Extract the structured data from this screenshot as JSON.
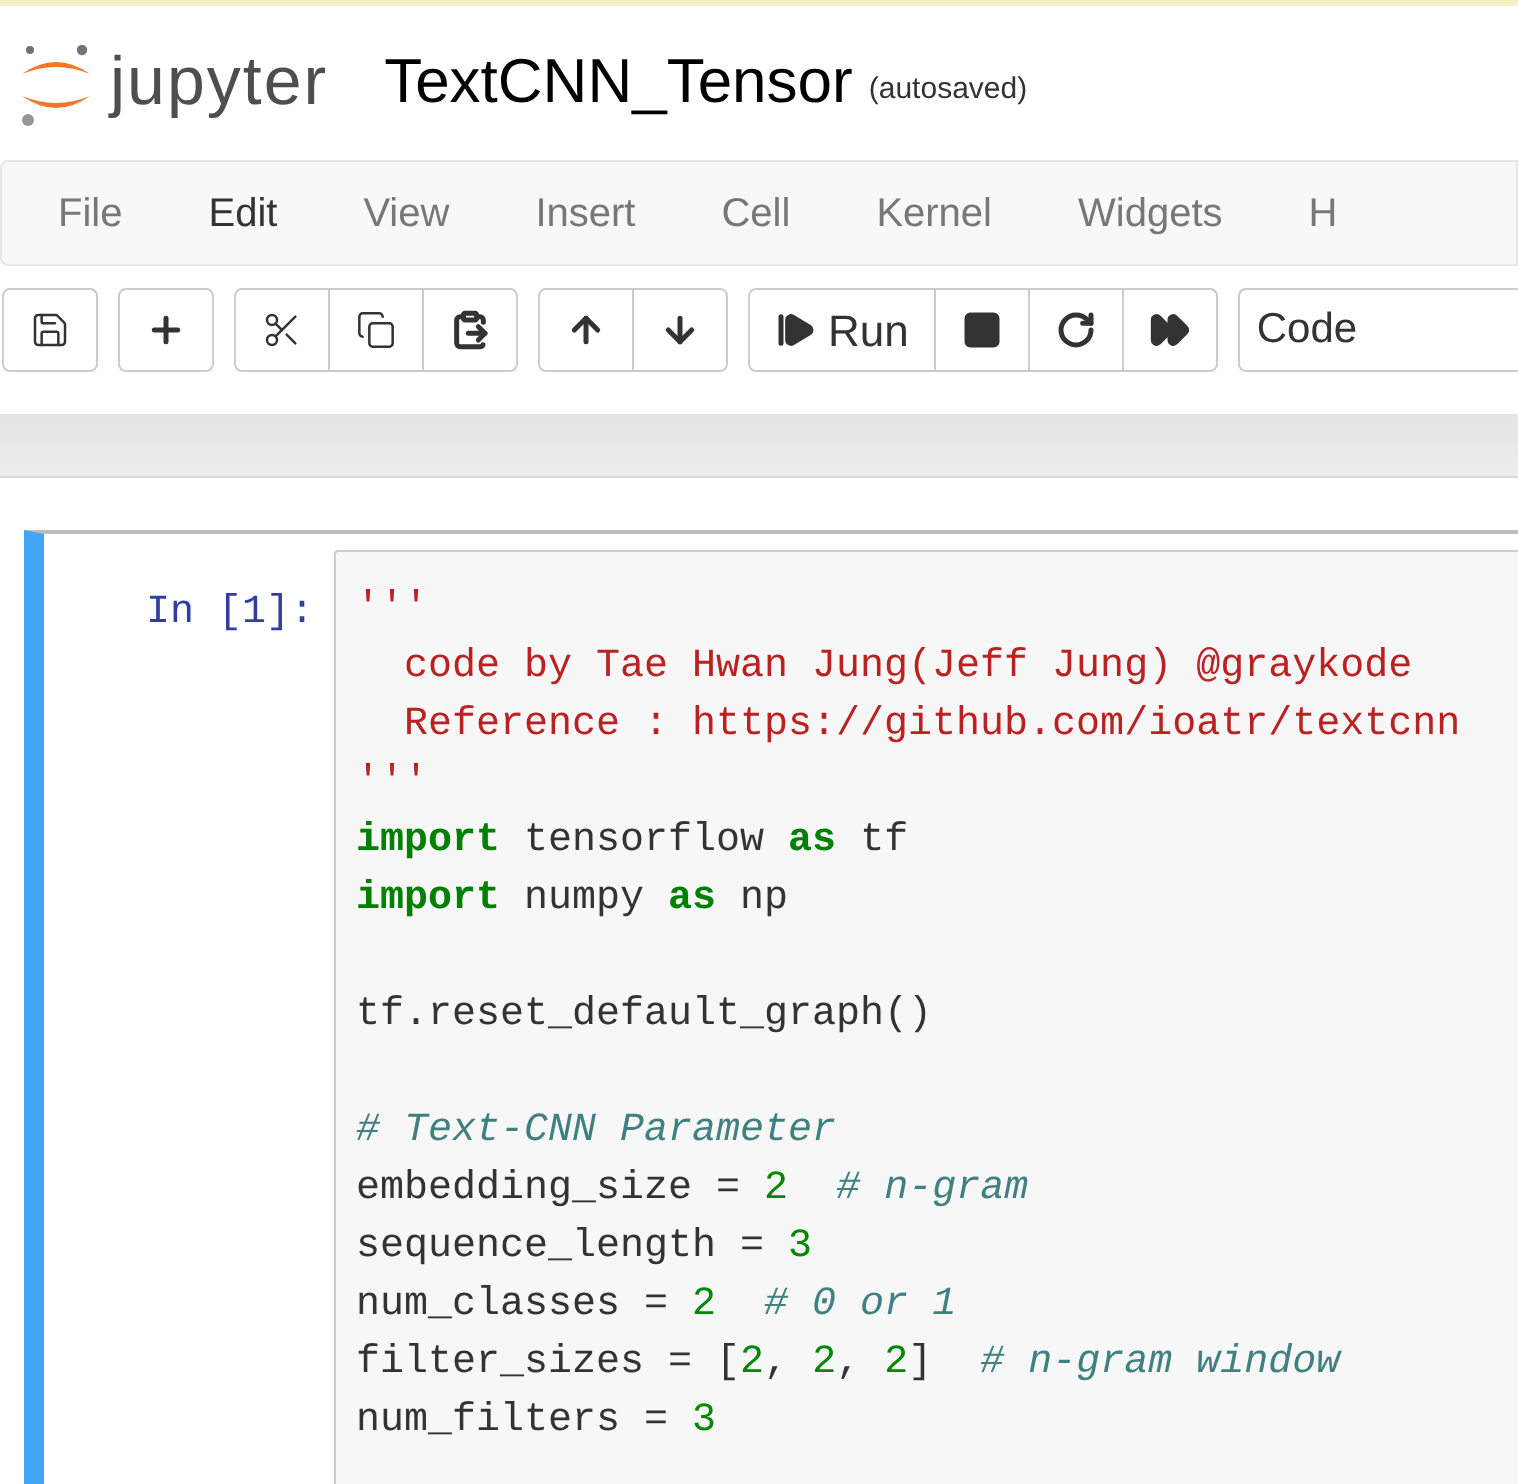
{
  "header": {
    "logo_text": "jupyter",
    "notebook_title": "TextCNN_Tensor",
    "save_status": "(autosaved)"
  },
  "menu": [
    {
      "label": "File",
      "selected": false
    },
    {
      "label": "Edit",
      "selected": true
    },
    {
      "label": "View",
      "selected": false
    },
    {
      "label": "Insert",
      "selected": false
    },
    {
      "label": "Cell",
      "selected": false
    },
    {
      "label": "Kernel",
      "selected": false
    },
    {
      "label": "Widgets",
      "selected": false
    },
    {
      "label": "H",
      "selected": false
    }
  ],
  "toolbar": {
    "run_label": "Run",
    "cell_type": "Code"
  },
  "cell": {
    "prompt": "In [1]:",
    "lines": [
      {
        "kind": "code",
        "tokens": [
          {
            "kind": "string",
            "text": "'''"
          }
        ]
      },
      {
        "kind": "code",
        "tokens": [
          {
            "kind": "string",
            "text": "  code by Tae Hwan Jung(Jeff Jung) @graykode"
          }
        ]
      },
      {
        "kind": "code",
        "tokens": [
          {
            "kind": "string",
            "text": "  Reference : https://github.com/ioatr/textcnn"
          }
        ]
      },
      {
        "kind": "code",
        "tokens": [
          {
            "kind": "string",
            "text": "'''"
          }
        ]
      },
      {
        "kind": "code",
        "tokens": [
          {
            "kind": "keyword",
            "text": "import"
          },
          {
            "kind": "plain",
            "text": " tensorflow "
          },
          {
            "kind": "keyword",
            "text": "as"
          },
          {
            "kind": "plain",
            "text": " tf"
          }
        ]
      },
      {
        "kind": "code",
        "tokens": [
          {
            "kind": "keyword",
            "text": "import"
          },
          {
            "kind": "plain",
            "text": " numpy "
          },
          {
            "kind": "keyword",
            "text": "as"
          },
          {
            "kind": "plain",
            "text": " np"
          }
        ]
      },
      {
        "kind": "blank"
      },
      {
        "kind": "code",
        "tokens": [
          {
            "kind": "plain",
            "text": "tf.reset_default_graph()"
          }
        ]
      },
      {
        "kind": "blank"
      },
      {
        "kind": "code",
        "tokens": [
          {
            "kind": "comment",
            "text": "# Text-CNN Parameter"
          }
        ]
      },
      {
        "kind": "code",
        "tokens": [
          {
            "kind": "plain",
            "text": "embedding_size = "
          },
          {
            "kind": "number",
            "text": "2"
          },
          {
            "kind": "comment",
            "text": "  # n-gram"
          }
        ]
      },
      {
        "kind": "code",
        "tokens": [
          {
            "kind": "plain",
            "text": "sequence_length = "
          },
          {
            "kind": "number",
            "text": "3"
          }
        ]
      },
      {
        "kind": "code",
        "tokens": [
          {
            "kind": "plain",
            "text": "num_classes = "
          },
          {
            "kind": "number",
            "text": "2"
          },
          {
            "kind": "comment",
            "text": "  # 0 or 1"
          }
        ]
      },
      {
        "kind": "code",
        "tokens": [
          {
            "kind": "plain",
            "text": "filter_sizes = ["
          },
          {
            "kind": "number",
            "text": "2"
          },
          {
            "kind": "plain",
            "text": ", "
          },
          {
            "kind": "number",
            "text": "2"
          },
          {
            "kind": "plain",
            "text": ", "
          },
          {
            "kind": "number",
            "text": "2"
          },
          {
            "kind": "plain",
            "text": "]  "
          },
          {
            "kind": "comment",
            "text": "# n-gram window"
          }
        ]
      },
      {
        "kind": "code",
        "tokens": [
          {
            "kind": "plain",
            "text": "num_filters = "
          },
          {
            "kind": "number",
            "text": "3"
          }
        ]
      }
    ]
  }
}
